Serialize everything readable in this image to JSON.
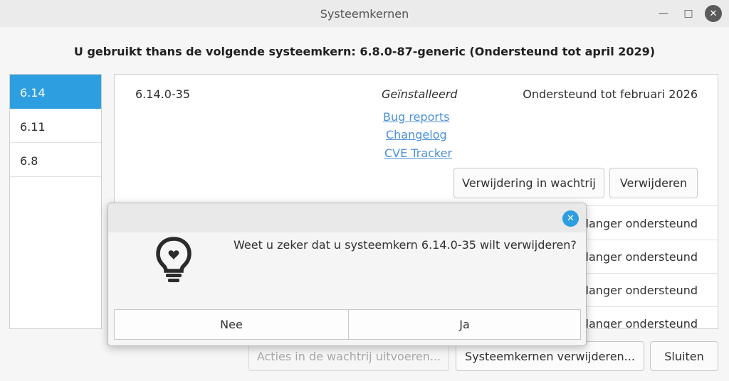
{
  "window": {
    "title": "Systeemkernen"
  },
  "headline": "U gebruikt thans de volgende systeemkern: 6.8.0-87-generic (Ondersteund tot april 2029)",
  "sidebar": {
    "items": [
      {
        "label": "6.14",
        "selected": true
      },
      {
        "label": "6.11",
        "selected": false
      },
      {
        "label": "6.8",
        "selected": false
      }
    ]
  },
  "kernel": {
    "version": "6.14.0-35",
    "status": "Geïnstalleerd",
    "support": "Ondersteund tot februari 2026",
    "links": [
      "Bug reports",
      "Changelog",
      "CVE Tracker"
    ],
    "queue_button": "Verwijdering in wachtrij",
    "remove_button": "Verwijderen"
  },
  "other_rows": [
    "langer ondersteund",
    "langer ondersteund",
    "langer ondersteund",
    "langer ondersteund"
  ],
  "footer": {
    "queue_actions": "Acties in de wachtrij uitvoeren...",
    "remove_kernels": "Systeemkernen verwijderen...",
    "close": "Sluiten"
  },
  "dialog": {
    "message": "Weet u zeker dat u systeemkern 6.14.0-35 wilt verwijderen?",
    "icon": "lightbulb-icon",
    "no": "Nee",
    "yes": "Ja"
  },
  "colors": {
    "accent": "#2d9fe0",
    "link": "#4a90d9"
  }
}
